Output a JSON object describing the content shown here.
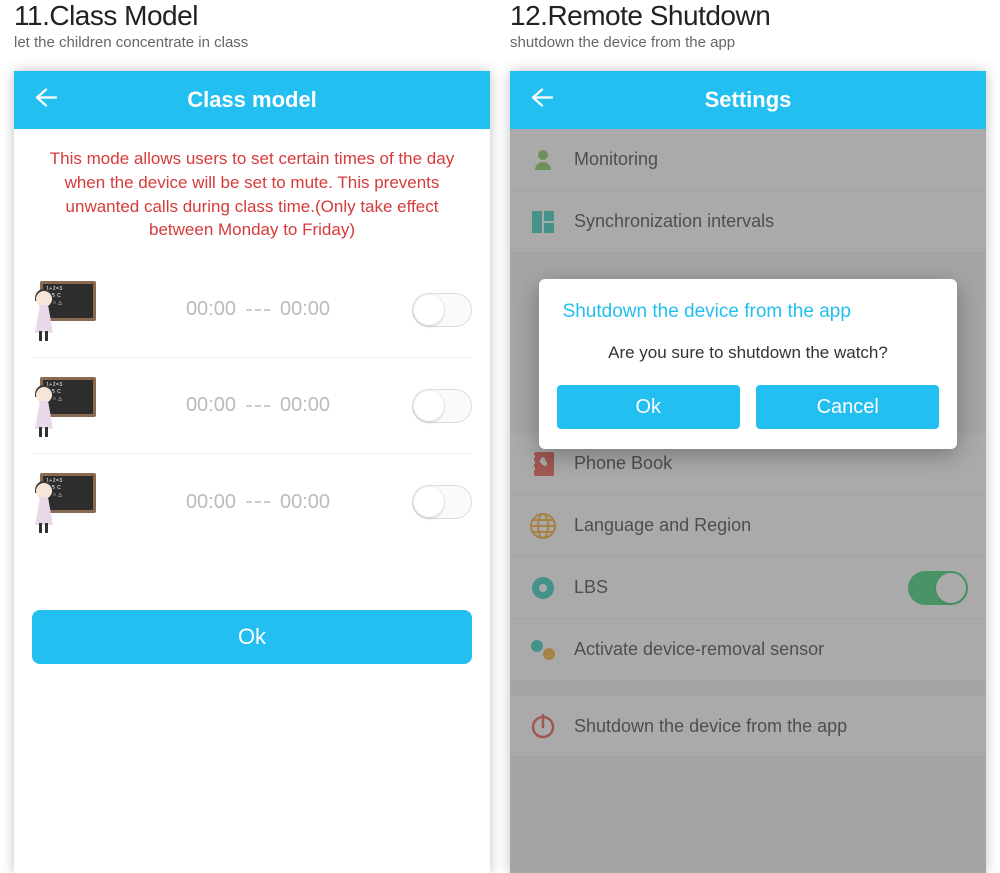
{
  "left": {
    "number": "11.",
    "feature": "Class Model",
    "subtitle": "let the children concentrate in class",
    "header": "Class model",
    "description": "This mode allows users to set certain times of the day when the device will be set to mute. This prevents unwanted calls during class time.(Only take effect between Monday to Friday)",
    "slots": [
      {
        "start": "00:00",
        "end": "00:00"
      },
      {
        "start": "00:00",
        "end": "00:00"
      },
      {
        "start": "00:00",
        "end": "00:00"
      }
    ],
    "ok": "Ok"
  },
  "right": {
    "number": "12.",
    "feature": "Remote Shutdown",
    "subtitle": "shutdown the device from the app",
    "header": "Settings",
    "items": {
      "monitoring": "Monitoring",
      "sync": "Synchronization intervals",
      "phonebook": "Phone Book",
      "language": "Language and Region",
      "lbs": "LBS",
      "sensor": "Activate device-removal sensor",
      "shutdown": "Shutdown the device from the app"
    },
    "dialog": {
      "title": "Shutdown the device from the app",
      "message": "Are you sure to shutdown the watch?",
      "ok": "Ok",
      "cancel": "Cancel"
    }
  }
}
